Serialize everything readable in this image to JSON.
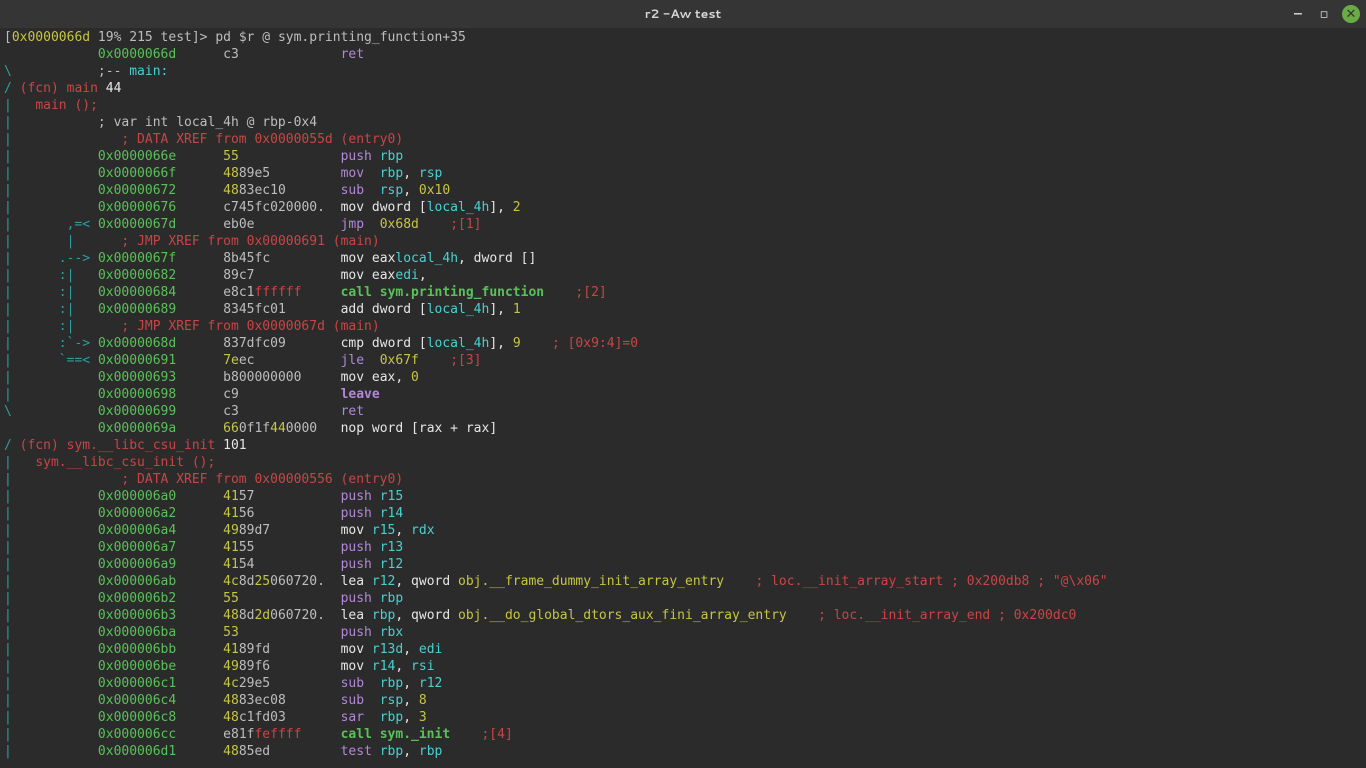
{
  "window": {
    "title": "r2 -Aw test"
  },
  "prompt": {
    "lbr": "[",
    "addr": "0x0000066d",
    "pct": " 19% 215 test",
    "rbr": "]> ",
    "cmd": "pd $r @ sym.printing_function+35"
  },
  "lines": [
    {
      "pre": "            ",
      "addr": "0x0000066d",
      "hex1": "",
      "hex2": "c3",
      "mnem": "ret",
      "ops": ""
    },
    {
      "pre": "\\           ",
      "plain": ";-- ",
      "plainC": "main:"
    },
    {
      "pre": "/ ",
      "fcn_red": "(fcn) main ",
      "fcn_white": "44"
    },
    {
      "pre": "|   ",
      "proto": "main ();"
    },
    {
      "pre": "|           ",
      "var": "; var int local_4h @ rbp-0x4"
    },
    {
      "pre": "|              ",
      "xref": "; DATA XREF from 0x0000055d (entry0)"
    },
    {
      "pre": "|           ",
      "addr": "0x0000066e",
      "hex1": "55",
      "hex2": "",
      "mnem": "push",
      "op1": "rbp"
    },
    {
      "pre": "|           ",
      "addr": "0x0000066f",
      "hex1": "48",
      "hex2": "89e5",
      "mnem": "mov",
      "op1": "rbp",
      "op2": ", ",
      "op3": "rsp"
    },
    {
      "pre": "|           ",
      "addr": "0x00000672",
      "hex1": "48",
      "hex2": "83ec10",
      "mnem": "sub",
      "op1": "rsp",
      "op2": ", ",
      "op3c": "0x10"
    },
    {
      "pre": "|           ",
      "addr": "0x00000676",
      "hex2": "c7",
      "hex2b": "45fc",
      "hex2c": "02",
      "hex2d": "0000.",
      "mnemw": "mov dword [",
      "op1": "local_4h",
      "close": "], ",
      "op3c": "2"
    },
    {
      "pre": "|       ",
      "arrow": ",=< ",
      "addr": "0x0000067d",
      "hex2": "eb0e",
      "mnem": "jmp",
      "op3c": "0x68d",
      "cmtR": ";[1]"
    },
    {
      "pre": "|       ",
      "arrowbar": "|      ",
      "xref": "; JMP XREF from 0x00000691 (main)"
    },
    {
      "pre": "|      ",
      "arrow": ".--> ",
      "addr": "0x0000067f",
      "hex2": "8b",
      "hex2b": "45fc",
      "mnemw": "mov ",
      "op_eax": "eax",
      "opw": ", dword [",
      "op1": "local_4h",
      "close": "]"
    },
    {
      "pre": "|      ",
      "arrowbar": ":|   ",
      "addr": "0x00000682",
      "hex2": "89c7",
      "mnemw": "mov ",
      "op1": "edi",
      "op2": ", ",
      "op_eax": "eax"
    },
    {
      "pre": "|      ",
      "arrowbar": ":|   ",
      "addr": "0x00000684",
      "hex2": "e8c1",
      "hexR": "ffffff",
      "callB": "call ",
      "callT": "sym.printing_function",
      "cmtR": ";[2]"
    },
    {
      "pre": "|      ",
      "arrowbar": ":|   ",
      "addr": "0x00000689",
      "hex2": "83",
      "hex2b": "45fc",
      "hex2c": "01",
      "mnemw": "add dword [",
      "op1": "local_4h",
      "close": "], ",
      "op3c": "1"
    },
    {
      "pre": "|      ",
      "arrowbar": ":|      ",
      "xref": "; JMP XREF from 0x0000067d (main)"
    },
    {
      "pre": "|      ",
      "arrow": ":`-> ",
      "addr": "0x0000068d",
      "hex2": "83",
      "hex2b": "7dfc",
      "hex2c": "09",
      "mnemw": "cmp dword [",
      "op1": "local_4h",
      "close": "], ",
      "op3c": "9",
      "cmtR": "; [0x9:4]=0"
    },
    {
      "pre": "|      ",
      "arrow": "`==< ",
      "addr": "0x00000691",
      "hex1": "7e",
      "hex2": "ec",
      "mnem": "jle",
      "op3c": "0x67f",
      "cmtR": ";[3]"
    },
    {
      "pre": "|           ",
      "addr": "0x00000693",
      "hex2": "b8",
      "hex2b": "00000000",
      "mnemw": "mov ",
      "op_eax": "eax",
      "op2": ", ",
      "op3c": "0"
    },
    {
      "pre": "|           ",
      "addr": "0x00000698",
      "hex2": "c9",
      "leaveB": "leave"
    },
    {
      "pre": "\\           ",
      "addr": "0x00000699",
      "hex2": "c3",
      "mnem": "ret"
    },
    {
      "pre": "            ",
      "addr": "0x0000069a",
      "hex1": "66",
      "hex2": "0f1f",
      "hex1b": "44",
      "hex2c": "0000",
      "mnemw": "nop word [",
      "op_eax": "rax",
      "plus": " + ",
      "op_eax2": "rax",
      "close": "]"
    },
    {
      "pre": "/ ",
      "fcn_red": "(fcn) sym.__libc_csu_init ",
      "fcn_white": "101"
    },
    {
      "pre": "|   ",
      "proto": "sym.__libc_csu_init ();"
    },
    {
      "pre": "|              ",
      "xref": "; DATA XREF from 0x00000556 (entry0)"
    },
    {
      "pre": "|           ",
      "addr": "0x000006a0",
      "hex1": "41",
      "hex2": "57",
      "mnem": "push",
      "op1": "r15"
    },
    {
      "pre": "|           ",
      "addr": "0x000006a2",
      "hex1": "41",
      "hex2": "56",
      "mnem": "push",
      "op1": "r14"
    },
    {
      "pre": "|           ",
      "addr": "0x000006a4",
      "hex1": "49",
      "hex2": "89d7",
      "mnemw": "mov ",
      "op1": "r15",
      "op2": ", ",
      "op3r": "rdx"
    },
    {
      "pre": "|           ",
      "addr": "0x000006a7",
      "hex1": "41",
      "hex2": "55",
      "mnem": "push",
      "op1": "r13"
    },
    {
      "pre": "|           ",
      "addr": "0x000006a9",
      "hex1": "41",
      "hex2": "54",
      "mnem": "push",
      "op1": "r12"
    },
    {
      "pre": "|           ",
      "addr": "0x000006ab",
      "hex1": "4c",
      "hex2": "8d",
      "hex1b": "25",
      "hex2c": "060720.",
      "mnemw": "lea ",
      "op1": "r12",
      "op2": ", qword ",
      "obj": "obj.__frame_dummy_init_array_entry",
      "cmtR": "; loc.__init_array_start ; 0x200db8 ; \"@\\x06\""
    },
    {
      "pre": "|           ",
      "addr": "0x000006b2",
      "hex1": "55",
      "hex2": "",
      "mnem": "push",
      "op1": "rbp"
    },
    {
      "pre": "|           ",
      "addr": "0x000006b3",
      "hex1": "48",
      "hex2": "8d",
      "hex1b": "2d",
      "hex2c": "060720.",
      "mnemw": "lea ",
      "op1": "rbp",
      "op2": ", qword ",
      "obj": "obj.__do_global_dtors_aux_fini_array_entry",
      "cmtR": "; loc.__init_array_end ; 0x200dc0"
    },
    {
      "pre": "|           ",
      "addr": "0x000006ba",
      "hex1": "53",
      "hex2": "",
      "mnem": "push",
      "op1": "rbx"
    },
    {
      "pre": "|           ",
      "addr": "0x000006bb",
      "hex1": "41",
      "hex2": "89fd",
      "mnemw": "mov ",
      "op1": "r13d",
      "op2": ", ",
      "op3r": "edi"
    },
    {
      "pre": "|           ",
      "addr": "0x000006be",
      "hex1": "49",
      "hex2": "89f6",
      "mnemw": "mov ",
      "op1": "r14",
      "op2": ", ",
      "op3r": "rsi"
    },
    {
      "pre": "|           ",
      "addr": "0x000006c1",
      "hex1": "4c",
      "hex2": "29e5",
      "mnem": "sub",
      "op1": "rbp",
      "op2": ", ",
      "op3r": "r12"
    },
    {
      "pre": "|           ",
      "addr": "0x000006c4",
      "hex1": "48",
      "hex2": "83ec08",
      "mnem": "sub",
      "op1": "rsp",
      "op2": ", ",
      "op3c": "8"
    },
    {
      "pre": "|           ",
      "addr": "0x000006c8",
      "hex1": "48",
      "hex2": "c1fd03",
      "mnem": "sar",
      "op1": "rbp",
      "op2": ", ",
      "op3c": "3"
    },
    {
      "pre": "|           ",
      "addr": "0x000006cc",
      "hex2": "e81f",
      "hexR": "feffff",
      "callB": "call ",
      "callT": "sym._init",
      "cmtR": ";[4]"
    },
    {
      "pre": "|           ",
      "addr": "0x000006d1",
      "hex1": "48",
      "hex2": "85ed",
      "mnem": "test",
      "op1": "rbp",
      "op2": ", ",
      "op3r": "rbp"
    }
  ]
}
